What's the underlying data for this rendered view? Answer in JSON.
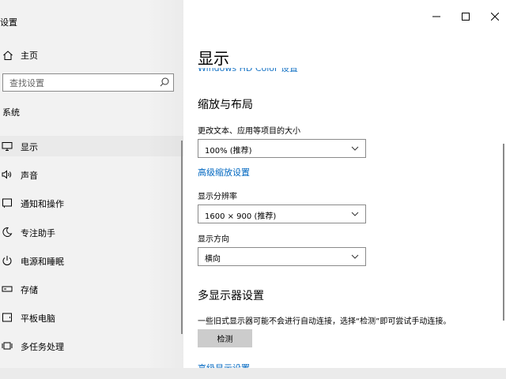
{
  "window": {
    "title": "设置",
    "minimize_icon": "minimize-icon",
    "maximize_icon": "maximize-icon",
    "close_icon": "close-icon"
  },
  "sidebar": {
    "home_label": "主页",
    "search_placeholder": "查找设置",
    "section_label": "系统",
    "items": [
      {
        "label": "显示",
        "icon": "monitor-icon"
      },
      {
        "label": "声音",
        "icon": "speaker-icon"
      },
      {
        "label": "通知和操作",
        "icon": "notification-icon"
      },
      {
        "label": "专注助手",
        "icon": "moon-icon"
      },
      {
        "label": "电源和睡眠",
        "icon": "power-icon"
      },
      {
        "label": "存储",
        "icon": "storage-icon"
      },
      {
        "label": "平板电脑",
        "icon": "tablet-icon"
      },
      {
        "label": "多任务处理",
        "icon": "multitask-icon"
      }
    ]
  },
  "main": {
    "page_title": "显示",
    "prev_link": "Windows HD Color 设置",
    "scale_section": {
      "heading": "缩放与布局",
      "text_size_label": "更改文本、应用等项目的大小",
      "text_size_value": "100% (推荐)",
      "advanced_link": "高级缩放设置",
      "resolution_label": "显示分辨率",
      "resolution_value": "1600 × 900 (推荐)",
      "orientation_label": "显示方向",
      "orientation_value": "横向"
    },
    "multi_section": {
      "heading": "多显示器设置",
      "description": "一些旧式显示器可能不会进行自动连接，选择“检测”即可尝试手动连接。",
      "detect_button": "检测",
      "next_link": "高级显示设置"
    }
  }
}
